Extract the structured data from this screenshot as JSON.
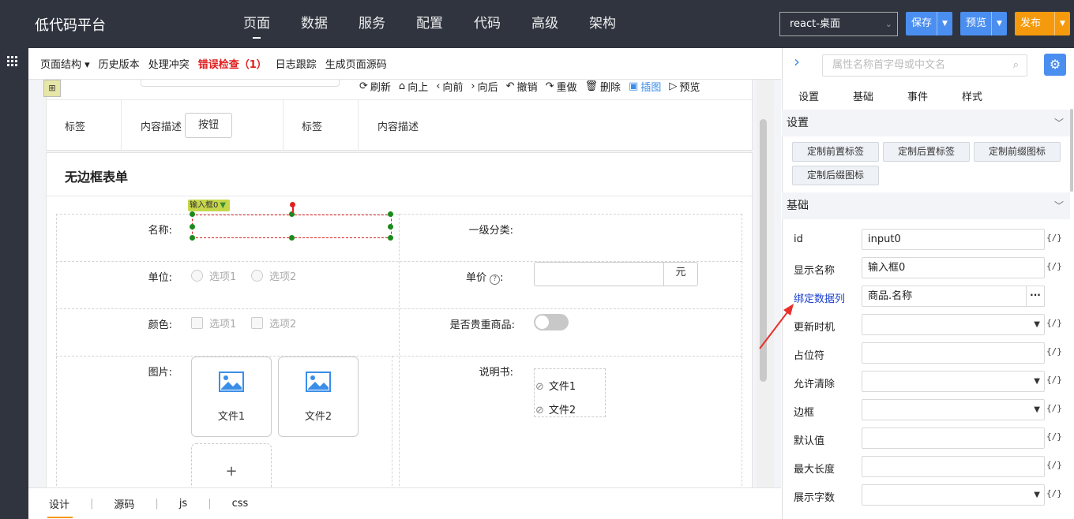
{
  "app": {
    "logo": "低代码平台"
  },
  "nav": {
    "items": [
      "页面",
      "数据",
      "服务",
      "配置",
      "代码",
      "高级",
      "架构"
    ],
    "active": 0
  },
  "top": {
    "framework": "react-桌面",
    "save": "保存",
    "preview": "预览",
    "publish": "发布"
  },
  "subtoolbar": {
    "items": [
      "页面结构 ▾",
      "历史版本",
      "处理冲突",
      "错误检查（1）",
      "日志跟踪",
      "生成页面源码"
    ]
  },
  "actions": [
    "刷新",
    "向上",
    "向前",
    "向后",
    "撤销",
    "重做",
    "删除",
    "插图",
    "预览"
  ],
  "card1": {
    "label_a": "标签",
    "desc_a": "内容描述",
    "button": "按钮",
    "label_b": "标签",
    "desc_b": "内容描述"
  },
  "form": {
    "title": "无边框表单",
    "selected_tag": "输入框0",
    "name_label": "名称:",
    "category_label": "一级分类:",
    "unit_label": "单位:",
    "unit_options": [
      "选项1",
      "选项2"
    ],
    "price_label": "单价",
    "price_suffix": "元",
    "color_label": "颜色:",
    "color_options": [
      "选项1",
      "选项2"
    ],
    "precious_label": "是否贵重商品:",
    "image_label": "图片:",
    "image_files": [
      "文件1",
      "文件2"
    ],
    "manual_label": "说明书:",
    "manual_files": [
      "文件1",
      "文件2"
    ]
  },
  "bottom_tabs": [
    "设计",
    "源码",
    "js",
    "css"
  ],
  "panel": {
    "search_placeholder": "属性名称首字母或中文名",
    "tabs": [
      "设置",
      "基础",
      "事件",
      "样式"
    ],
    "section_settings": "设置",
    "chips": [
      "定制前置标签",
      "定制后置标签",
      "定制前缀图标",
      "定制后缀图标"
    ],
    "section_basic": "基础",
    "fx": "{/}",
    "props": [
      {
        "label": "id",
        "value": "input0"
      },
      {
        "label": "显示名称",
        "value": "输入框0"
      },
      {
        "label": "绑定数据列",
        "value": "商品.名称"
      },
      {
        "label": "更新时机",
        "value": ""
      },
      {
        "label": "占位符",
        "value": ""
      },
      {
        "label": "允许清除",
        "value": ""
      },
      {
        "label": "边框",
        "value": ""
      },
      {
        "label": "默认值",
        "value": ""
      },
      {
        "label": "最大长度",
        "value": ""
      },
      {
        "label": "展示字数",
        "value": ""
      }
    ]
  },
  "colors": {
    "topbar": "#2f343f",
    "accent": "#4a8ef0",
    "publish": "#f59a0d",
    "error": "#e02020",
    "link": "#1a3fd0",
    "arrow": "#e8302a"
  }
}
